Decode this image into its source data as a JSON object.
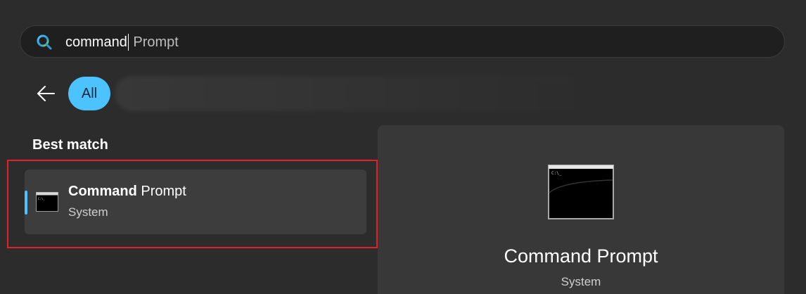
{
  "search": {
    "typed_text": "command",
    "suggestion_text": " Prompt"
  },
  "filters": {
    "all_label": "All"
  },
  "best_match": {
    "section_title": "Best match",
    "item": {
      "title_bold": "Command",
      "title_rest": " Prompt",
      "subtitle": "System",
      "icon": "command-prompt-icon"
    }
  },
  "preview": {
    "title": "Command Prompt",
    "subtitle": "System",
    "icon": "command-prompt-icon"
  },
  "colors": {
    "accent": "#4cc2ff",
    "highlight_outline": "#e0202a",
    "background": "#2c2c2c"
  }
}
